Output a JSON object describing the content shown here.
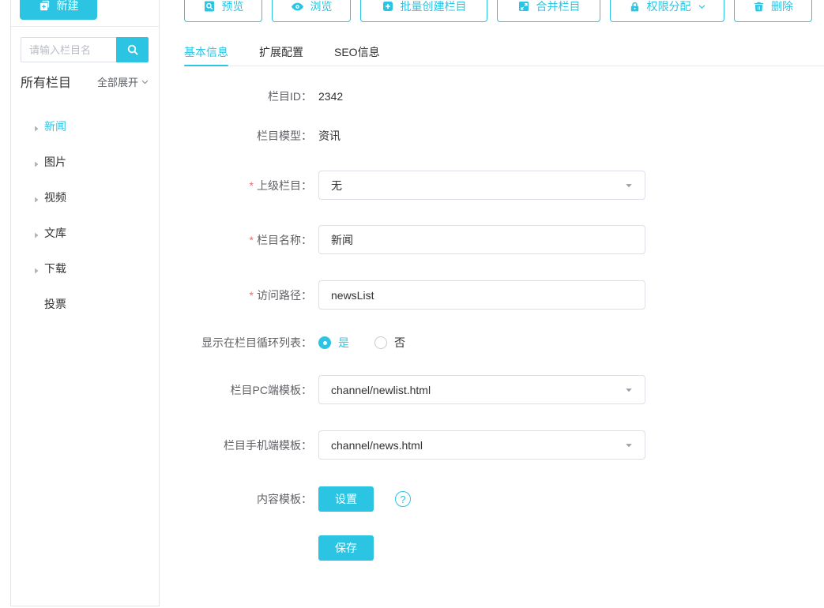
{
  "colors": {
    "primary": "#2bc5e3",
    "label_text": "#606266",
    "value_text": "#303133",
    "input_border": "#dcdfe6",
    "tab_divider": "#e4e7ed",
    "required_red": "#f56c6c"
  },
  "sidebar": {
    "new_button_label": "新建",
    "search_placeholder": "请输入栏目名",
    "all_channels_label": "所有栏目",
    "expand_all_label": "全部展开",
    "tree": [
      {
        "label": "新闻",
        "active": true,
        "leaf": false
      },
      {
        "label": "图片",
        "active": false,
        "leaf": false
      },
      {
        "label": "视频",
        "active": false,
        "leaf": false
      },
      {
        "label": "文库",
        "active": false,
        "leaf": false
      },
      {
        "label": "下载",
        "active": false,
        "leaf": false
      },
      {
        "label": "投票",
        "active": false,
        "leaf": true
      }
    ]
  },
  "toolbar": {
    "buttons": [
      {
        "label": "预览",
        "icon": "preview-icon"
      },
      {
        "label": "浏览",
        "icon": "browse-eye-icon"
      },
      {
        "label": "批量创建栏目",
        "icon": "batch-create-icon"
      },
      {
        "label": "合并栏目",
        "icon": "merge-icon"
      },
      {
        "label": "权限分配",
        "icon": "lock-icon",
        "has_dropdown": true
      },
      {
        "label": "删除",
        "icon": "trash-icon"
      }
    ]
  },
  "tabs": [
    {
      "label": "基本信息",
      "active": true
    },
    {
      "label": "扩展配置",
      "active": false
    },
    {
      "label": "SEO信息",
      "active": false
    }
  ],
  "form": {
    "required_marker": "*",
    "channel_id": {
      "label": "栏目ID：",
      "value": "2342"
    },
    "channel_model": {
      "label": "栏目模型：",
      "value": "资讯"
    },
    "parent_channel": {
      "label": "上级栏目：",
      "required": true,
      "value": "无"
    },
    "channel_name": {
      "label": "栏目名称：",
      "required": true,
      "value": "新闻"
    },
    "access_path": {
      "label": "访问路径：",
      "required": true,
      "value": "newsList"
    },
    "show_in_loop": {
      "label": "显示在栏目循环列表：",
      "options": [
        {
          "label": "是",
          "selected": true
        },
        {
          "label": "否",
          "selected": false
        }
      ]
    },
    "pc_template": {
      "label": "栏目PC端模板：",
      "value": "channel/newlist.html"
    },
    "mobile_template": {
      "label": "栏目手机端模板：",
      "value": "channel/news.html"
    },
    "content_template": {
      "label": "内容模板：",
      "button_label": "设置",
      "help_glyph": "?"
    },
    "save_button_label": "保存"
  }
}
